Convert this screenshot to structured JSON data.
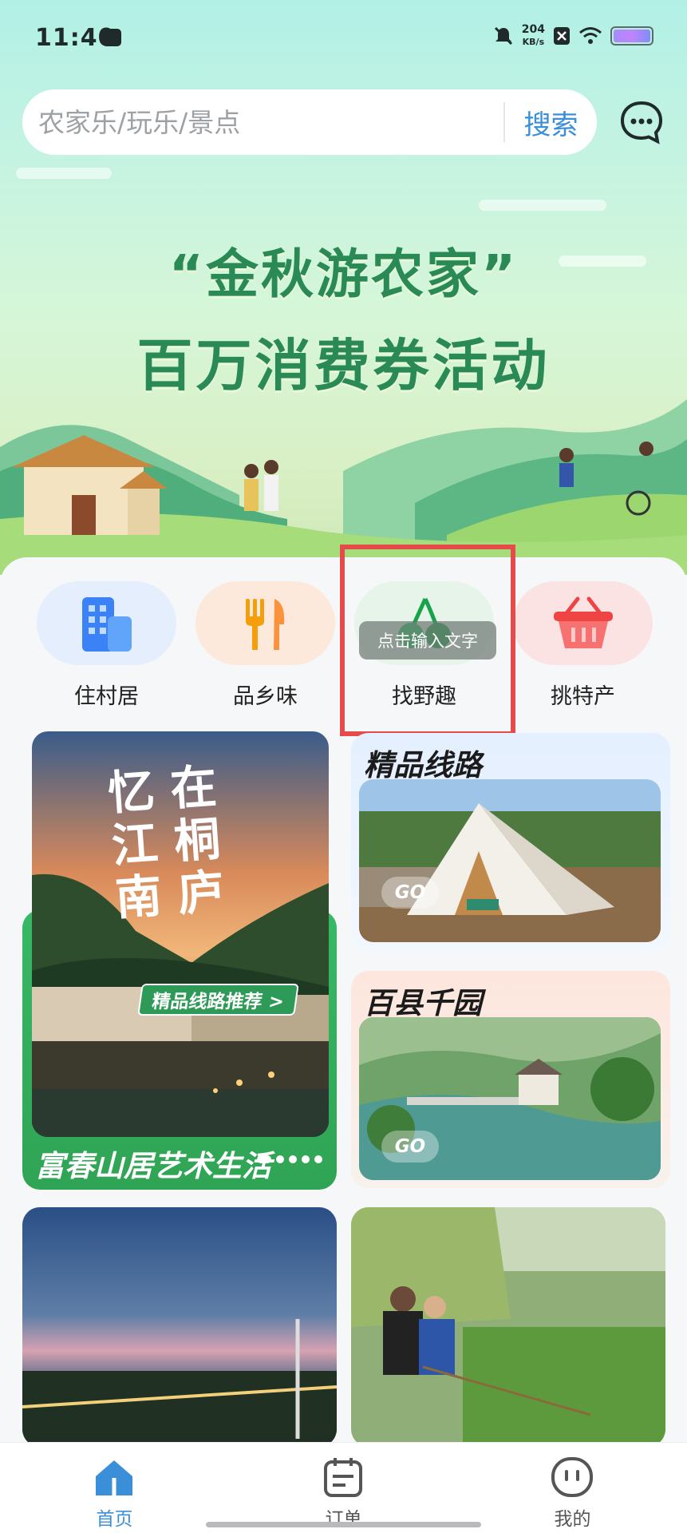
{
  "status_bar": {
    "time": "11:40",
    "net_speed_value": "204",
    "net_speed_unit": "KB/s",
    "icons": [
      "message-icon",
      "mute-icon",
      "sim-off-icon",
      "wifi-icon",
      "battery-icon"
    ]
  },
  "search": {
    "placeholder": "农家乐/玩乐/景点",
    "button_label": "搜索",
    "chat_icon": "chat-bubble-icon"
  },
  "banner": {
    "line1": "“金秋游农家”",
    "line2": "百万消费券活动"
  },
  "categories": [
    {
      "label": "住村居",
      "icon": "building-icon",
      "bg": "#e4eefc"
    },
    {
      "label": "品乡味",
      "icon": "fork-knife-icon",
      "bg": "#fde9dc"
    },
    {
      "label": "找野趣",
      "icon": "cherry-icon",
      "bg": "#e6f4ea"
    },
    {
      "label": "挑特产",
      "icon": "basket-icon",
      "bg": "#fbe3e4"
    }
  ],
  "overlay": {
    "tooltip": "点击输入文字"
  },
  "cards": {
    "featured": {
      "poster_text": [
        "忆",
        "在",
        "江",
        "桐",
        "南",
        "庐"
      ],
      "tag": "精品线路推荐 >",
      "caption": "富春山居艺术生活"
    },
    "route": {
      "title": "精品线路",
      "go": "GO"
    },
    "counties": {
      "title": "百县千园",
      "go": "GO"
    }
  },
  "bottom_nav": [
    {
      "label": "首页",
      "icon": "home-icon",
      "active": true
    },
    {
      "label": "订单",
      "icon": "calendar-icon",
      "active": false
    },
    {
      "label": "我的",
      "icon": "face-icon",
      "active": false
    }
  ],
  "colors": {
    "accent": "#3b8fd9",
    "brand_green": "#2a8a55",
    "highlight_red": "#e64b4b"
  }
}
